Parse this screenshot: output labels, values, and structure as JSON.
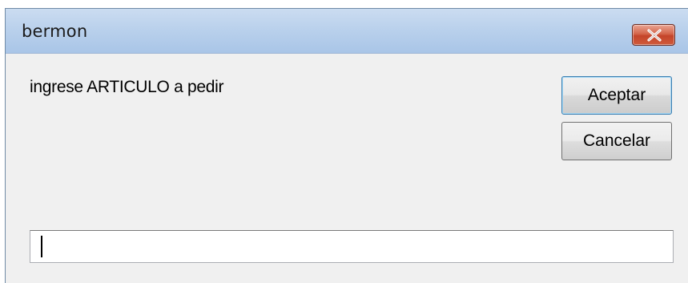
{
  "window": {
    "title": "bermon",
    "close_icon": "close-icon"
  },
  "dialog": {
    "prompt": "ingrese ARTICULO a pedir",
    "accept_label": "Aceptar",
    "cancel_label": "Cancelar",
    "input_value": ""
  },
  "colors": {
    "titlebar": "#bad1ec",
    "close_button": "#c4442a",
    "body": "#f0f0f0"
  }
}
